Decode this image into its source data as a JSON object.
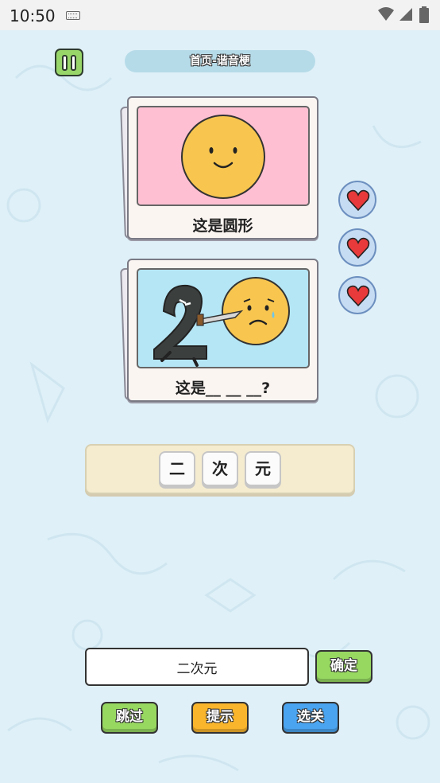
{
  "status": {
    "time": "10:50"
  },
  "header": {
    "title": "首页-谐音梗"
  },
  "cards": [
    {
      "caption": "这是圆形",
      "bg_color": "#ffbfd2"
    },
    {
      "caption": "这是__ __ __?",
      "bg_color": "#b5e6f5"
    }
  ],
  "lives": 3,
  "tiles": [
    "二",
    "次",
    "元"
  ],
  "answer": {
    "value": "二次元"
  },
  "buttons": {
    "confirm": "确定",
    "skip": "跳过",
    "hint": "提示",
    "select_level": "选关"
  },
  "colors": {
    "background": "#dff0f8",
    "green_button": "#97d861",
    "orange_button": "#f9b52c",
    "blue_button": "#4aa4f0",
    "heart": "#e83a3a"
  }
}
